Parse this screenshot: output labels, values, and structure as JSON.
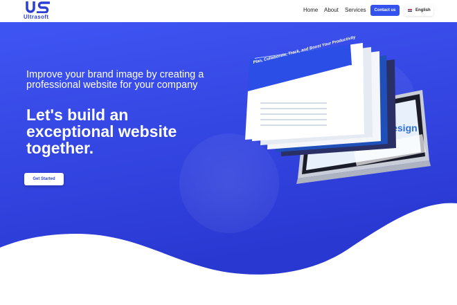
{
  "brand": {
    "logo_letters": "US",
    "name": "Ultrasoft"
  },
  "nav": {
    "home": "Home",
    "about": "About",
    "services": "Services"
  },
  "contact_button": "Contact us",
  "language": {
    "label": "English",
    "flag_icon": "us-flag-icon"
  },
  "hero": {
    "subtitle": "Improve your brand image by creating a professional website for your company",
    "title": "Let's build an exceptional website together.",
    "cta": "Get Started"
  },
  "mockup": {
    "front_screen_heading": "Plan, Collaborate, Track, and Boost Your Productivity",
    "side_screen_word": "Design",
    "partial_word": "es"
  },
  "colors": {
    "primary": "#3352ee",
    "hero_top": "#3f55f3",
    "hero_bottom": "#2a3ad6",
    "white": "#ffffff"
  }
}
